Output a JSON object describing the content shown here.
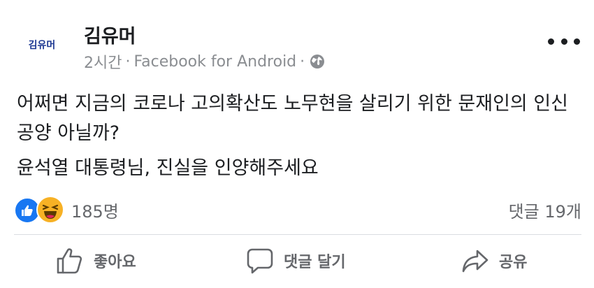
{
  "post": {
    "author": "김유머",
    "avatar_text": "김유머",
    "time": "2시간",
    "separator": "·",
    "source": "Facebook for Android",
    "privacy_icon": "globe-icon",
    "more_icon": "more-dots-icon",
    "text_line1": "어쩌면 지금의 코로나 고의확산도 노무현을 살리기 위한 문재인의 인신공양 아닐까?",
    "text_line2": "윤석열 대통령님, 진실을 인양해주세요"
  },
  "reactions": {
    "icons": [
      "like-icon",
      "haha-icon"
    ],
    "count": "185명",
    "comments": "댓글 19개"
  },
  "actions": {
    "like_label": "좋아요",
    "comment_label": "댓글 달기",
    "share_label": "공유"
  },
  "colors": {
    "text": "#1c1e21",
    "secondary": "#65676b",
    "meta": "#8a8d91",
    "like_blue": "#1877f2",
    "haha_yellow": "#f7b125",
    "divider": "#dadde1"
  }
}
